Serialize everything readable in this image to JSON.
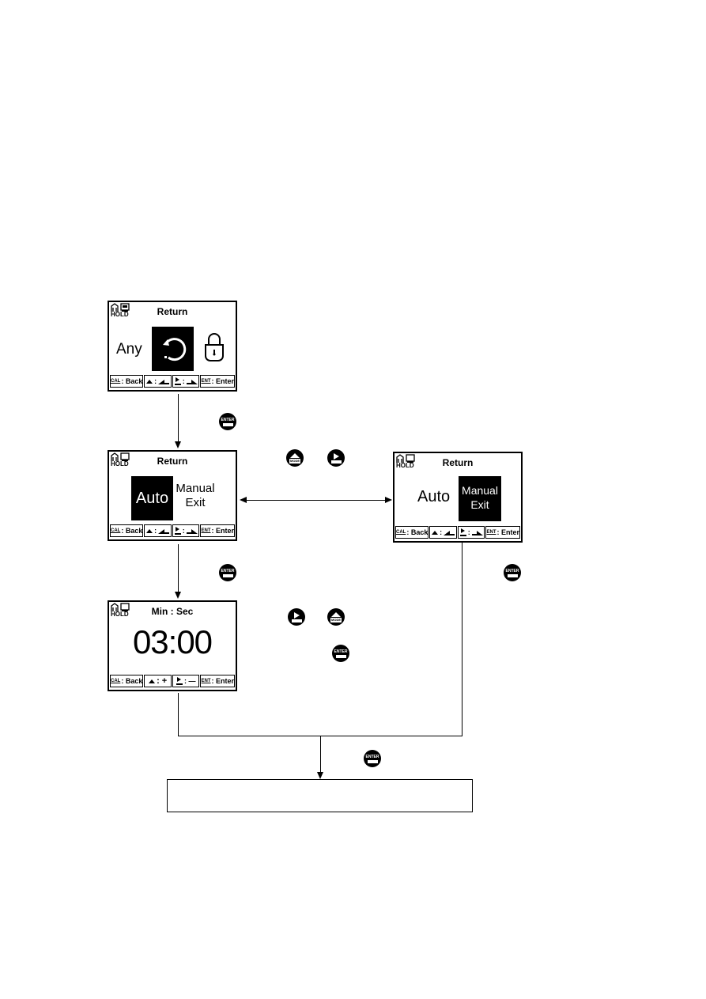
{
  "screens": {
    "return_select": {
      "status": {
        "hold_label": "HOLD"
      },
      "title": "Return",
      "left_text": "Any",
      "center_icon": "return-arrow-icon",
      "right_icon": "lock-icon",
      "softkeys": [
        {
          "key": "CAL",
          "label": ": Back"
        },
        {
          "key": "up",
          "label": ":"
        },
        {
          "key": "right",
          "label": ":"
        },
        {
          "key": "ENT",
          "label": ": Enter"
        }
      ]
    },
    "return_auto": {
      "status": {
        "hold_label": "HOLD"
      },
      "title": "Return",
      "options": [
        "Auto",
        "Manual",
        "Exit"
      ],
      "selected": "Auto",
      "softkeys": [
        {
          "key": "CAL",
          "label": ": Back"
        },
        {
          "key": "up",
          "label": ":"
        },
        {
          "key": "right",
          "label": ":"
        },
        {
          "key": "ENT",
          "label": ": Enter"
        }
      ]
    },
    "return_manual": {
      "status": {
        "hold_label": "HOLD"
      },
      "title": "Return",
      "options": [
        "Auto",
        "Manual",
        "Exit"
      ],
      "selected": "Manual Exit",
      "softkeys": [
        {
          "key": "CAL",
          "label": ": Back"
        },
        {
          "key": "up",
          "label": ":"
        },
        {
          "key": "right",
          "label": ":"
        },
        {
          "key": "ENT",
          "label": ": Enter"
        }
      ]
    },
    "time_set": {
      "status": {
        "hold_label": "HOLD"
      },
      "title": "Min : Sec",
      "value": "03:00",
      "softkeys": [
        {
          "key": "CAL",
          "label": ": Back"
        },
        {
          "key": "up",
          "label": ": +"
        },
        {
          "key": "right",
          "label": ": —"
        },
        {
          "key": "ENT",
          "label": ": Enter"
        }
      ]
    }
  },
  "keys": {
    "enter": "ENTER",
    "mode": "MODE"
  },
  "result_box": {
    "text": ""
  }
}
